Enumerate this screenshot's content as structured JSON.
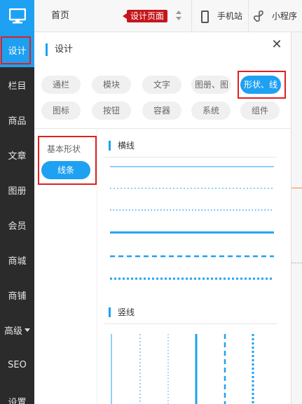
{
  "sidebar": {
    "items": [
      {
        "label": "设计"
      },
      {
        "label": "栏目"
      },
      {
        "label": "商品"
      },
      {
        "label": "文章"
      },
      {
        "label": "图册"
      },
      {
        "label": "会员"
      },
      {
        "label": "商城"
      },
      {
        "label": "商铺"
      },
      {
        "label": "高级"
      },
      {
        "label": "SEO"
      },
      {
        "label": "设置"
      }
    ]
  },
  "topbar": {
    "home": "首页",
    "page_tag": "设计页面",
    "mobile": "手机站",
    "mini_program": "小程序"
  },
  "panel": {
    "title": "设计",
    "categories": [
      "通栏",
      "模块",
      "文字",
      "图册、图",
      "形状、线",
      "图标",
      "按钮",
      "容器",
      "系统",
      "组件"
    ],
    "active_category": "形状、线",
    "subnav": {
      "label": "基本形状",
      "active": "线条"
    },
    "sections": {
      "horizontal": "横线",
      "vertical": "竖线"
    }
  },
  "colors": {
    "accent": "#1ea1f2",
    "sidebar_bg": "#2b2b2b",
    "highlight_box": "#e02020",
    "tag_bg": "#c4161c"
  }
}
